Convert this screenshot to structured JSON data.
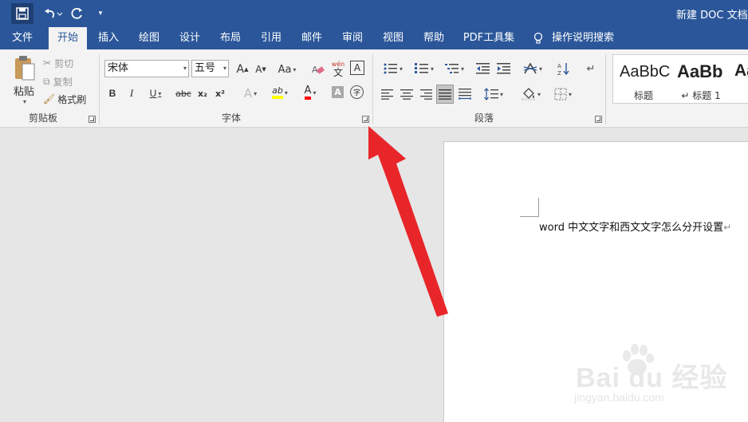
{
  "titlebar": {
    "doc_title": "新建 DOC 文档.d",
    "customize_glyph": "▾"
  },
  "tabs": [
    {
      "label": "文件"
    },
    {
      "label": "开始"
    },
    {
      "label": "插入"
    },
    {
      "label": "绘图"
    },
    {
      "label": "设计"
    },
    {
      "label": "布局"
    },
    {
      "label": "引用"
    },
    {
      "label": "邮件"
    },
    {
      "label": "审阅"
    },
    {
      "label": "视图"
    },
    {
      "label": "帮助"
    },
    {
      "label": "PDF工具集"
    },
    {
      "label": "操作说明搜索"
    }
  ],
  "clipboard": {
    "paste_label": "粘贴",
    "cut_label": "剪切",
    "copy_label": "复制",
    "format_painter_label": "格式刷",
    "group_label": "剪贴板"
  },
  "font": {
    "font_name": "宋体",
    "font_size": "五号",
    "group_label": "字体",
    "grow_label": "A",
    "shrink_label": "A",
    "case_label": "Aa",
    "phonetic_label": "wén",
    "phonetic_char": "文",
    "border_char": "A",
    "bold_label": "B",
    "italic_label": "I",
    "underline_label": "U",
    "strike_label": "abc",
    "subscript_label": "x₂",
    "superscript_label": "x²",
    "effects_label": "A",
    "highlight_label": "ab",
    "color_label": "A",
    "shading_label": "A",
    "enclose_label": "字"
  },
  "paragraph": {
    "group_label": "段落"
  },
  "styles": {
    "items": [
      {
        "sample": "AaBbC",
        "name": "标题"
      },
      {
        "sample": "AaBb",
        "name": "↵ 标题 1"
      },
      {
        "sample": "Aa",
        "name": ""
      }
    ]
  },
  "document": {
    "text": "word 中文文字和西文文字怎么分开设置",
    "para_mark": "↵"
  },
  "watermark": {
    "brand": "Bai du 经验",
    "url": "jingyan.baidu.com"
  },
  "colors": {
    "titlebar": "#2b579a",
    "ribbon": "#f3f3f3",
    "arrow": "#e8262a",
    "highlight": "#ffff00",
    "font_color": "#ff0000"
  }
}
